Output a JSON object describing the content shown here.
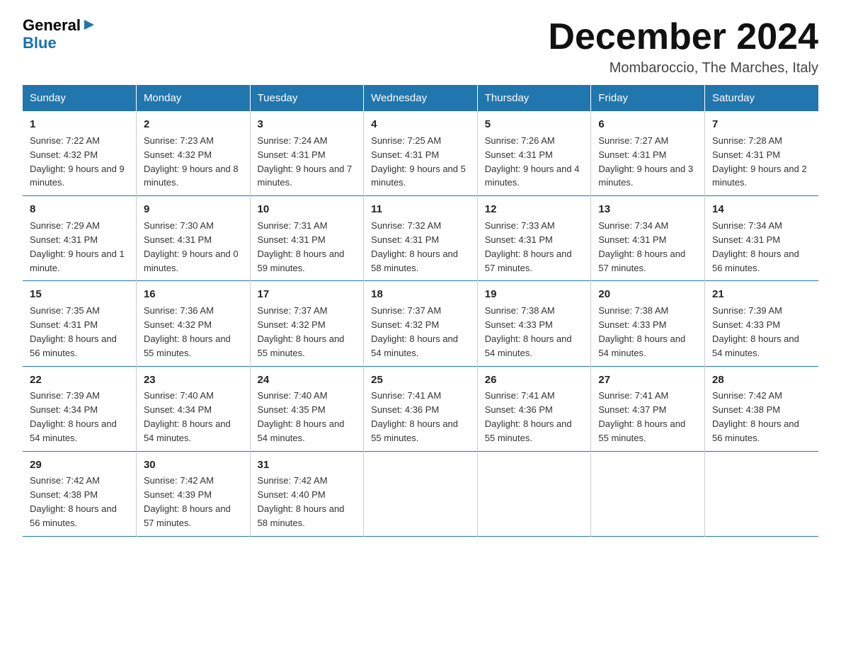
{
  "logo": {
    "line1": "General",
    "arrow": "▶",
    "line2": "Blue"
  },
  "title": "December 2024",
  "subtitle": "Mombaroccio, The Marches, Italy",
  "days_header": [
    "Sunday",
    "Monday",
    "Tuesday",
    "Wednesday",
    "Thursday",
    "Friday",
    "Saturday"
  ],
  "weeks": [
    [
      {
        "day": "1",
        "sunrise": "7:22 AM",
        "sunset": "4:32 PM",
        "daylight": "9 hours and 9 minutes."
      },
      {
        "day": "2",
        "sunrise": "7:23 AM",
        "sunset": "4:32 PM",
        "daylight": "9 hours and 8 minutes."
      },
      {
        "day": "3",
        "sunrise": "7:24 AM",
        "sunset": "4:31 PM",
        "daylight": "9 hours and 7 minutes."
      },
      {
        "day": "4",
        "sunrise": "7:25 AM",
        "sunset": "4:31 PM",
        "daylight": "9 hours and 5 minutes."
      },
      {
        "day": "5",
        "sunrise": "7:26 AM",
        "sunset": "4:31 PM",
        "daylight": "9 hours and 4 minutes."
      },
      {
        "day": "6",
        "sunrise": "7:27 AM",
        "sunset": "4:31 PM",
        "daylight": "9 hours and 3 minutes."
      },
      {
        "day": "7",
        "sunrise": "7:28 AM",
        "sunset": "4:31 PM",
        "daylight": "9 hours and 2 minutes."
      }
    ],
    [
      {
        "day": "8",
        "sunrise": "7:29 AM",
        "sunset": "4:31 PM",
        "daylight": "9 hours and 1 minute."
      },
      {
        "day": "9",
        "sunrise": "7:30 AM",
        "sunset": "4:31 PM",
        "daylight": "9 hours and 0 minutes."
      },
      {
        "day": "10",
        "sunrise": "7:31 AM",
        "sunset": "4:31 PM",
        "daylight": "8 hours and 59 minutes."
      },
      {
        "day": "11",
        "sunrise": "7:32 AM",
        "sunset": "4:31 PM",
        "daylight": "8 hours and 58 minutes."
      },
      {
        "day": "12",
        "sunrise": "7:33 AM",
        "sunset": "4:31 PM",
        "daylight": "8 hours and 57 minutes."
      },
      {
        "day": "13",
        "sunrise": "7:34 AM",
        "sunset": "4:31 PM",
        "daylight": "8 hours and 57 minutes."
      },
      {
        "day": "14",
        "sunrise": "7:34 AM",
        "sunset": "4:31 PM",
        "daylight": "8 hours and 56 minutes."
      }
    ],
    [
      {
        "day": "15",
        "sunrise": "7:35 AM",
        "sunset": "4:31 PM",
        "daylight": "8 hours and 56 minutes."
      },
      {
        "day": "16",
        "sunrise": "7:36 AM",
        "sunset": "4:32 PM",
        "daylight": "8 hours and 55 minutes."
      },
      {
        "day": "17",
        "sunrise": "7:37 AM",
        "sunset": "4:32 PM",
        "daylight": "8 hours and 55 minutes."
      },
      {
        "day": "18",
        "sunrise": "7:37 AM",
        "sunset": "4:32 PM",
        "daylight": "8 hours and 54 minutes."
      },
      {
        "day": "19",
        "sunrise": "7:38 AM",
        "sunset": "4:33 PM",
        "daylight": "8 hours and 54 minutes."
      },
      {
        "day": "20",
        "sunrise": "7:38 AM",
        "sunset": "4:33 PM",
        "daylight": "8 hours and 54 minutes."
      },
      {
        "day": "21",
        "sunrise": "7:39 AM",
        "sunset": "4:33 PM",
        "daylight": "8 hours and 54 minutes."
      }
    ],
    [
      {
        "day": "22",
        "sunrise": "7:39 AM",
        "sunset": "4:34 PM",
        "daylight": "8 hours and 54 minutes."
      },
      {
        "day": "23",
        "sunrise": "7:40 AM",
        "sunset": "4:34 PM",
        "daylight": "8 hours and 54 minutes."
      },
      {
        "day": "24",
        "sunrise": "7:40 AM",
        "sunset": "4:35 PM",
        "daylight": "8 hours and 54 minutes."
      },
      {
        "day": "25",
        "sunrise": "7:41 AM",
        "sunset": "4:36 PM",
        "daylight": "8 hours and 55 minutes."
      },
      {
        "day": "26",
        "sunrise": "7:41 AM",
        "sunset": "4:36 PM",
        "daylight": "8 hours and 55 minutes."
      },
      {
        "day": "27",
        "sunrise": "7:41 AM",
        "sunset": "4:37 PM",
        "daylight": "8 hours and 55 minutes."
      },
      {
        "day": "28",
        "sunrise": "7:42 AM",
        "sunset": "4:38 PM",
        "daylight": "8 hours and 56 minutes."
      }
    ],
    [
      {
        "day": "29",
        "sunrise": "7:42 AM",
        "sunset": "4:38 PM",
        "daylight": "8 hours and 56 minutes."
      },
      {
        "day": "30",
        "sunrise": "7:42 AM",
        "sunset": "4:39 PM",
        "daylight": "8 hours and 57 minutes."
      },
      {
        "day": "31",
        "sunrise": "7:42 AM",
        "sunset": "4:40 PM",
        "daylight": "8 hours and 58 minutes."
      },
      null,
      null,
      null,
      null
    ]
  ],
  "labels": {
    "sunrise": "Sunrise:",
    "sunset": "Sunset:",
    "daylight": "Daylight:"
  }
}
